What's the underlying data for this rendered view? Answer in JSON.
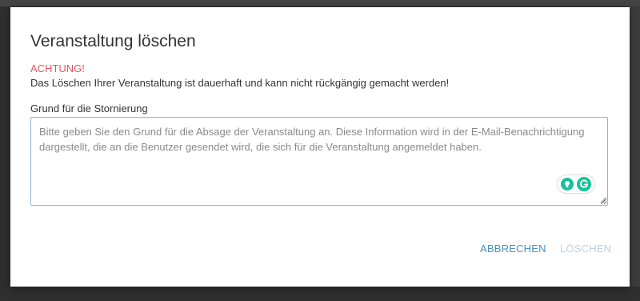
{
  "dialog": {
    "title": "Veranstaltung löschen",
    "warning_label": "ACHTUNG!",
    "warning_text": "Das Löschen Ihrer Veranstaltung ist dauerhaft und kann nicht rückgängig gemacht werden!",
    "reason": {
      "label": "Grund für die Stornierung",
      "value": "",
      "placeholder": "Bitte geben Sie den Grund für die Absage der Veranstaltung an. Diese Information wird in der E-Mail-Benachrichtigung dargestellt, die an die Benutzer gesendet wird, die sich für die Veranstaltung angemeldet haben."
    },
    "buttons": {
      "cancel_label": "ABBRECHEN",
      "delete_label": "LÖSCHEN"
    }
  },
  "colors": {
    "warning": "#e15a5a",
    "primary": "#4a8fc1",
    "primary_disabled": "#b7d3e8",
    "grammarly": "#15c39a"
  },
  "icons": {
    "grammarly_suggestion": "lightbulb-icon",
    "grammarly_logo": "grammarly-g-icon",
    "resize": "resize-grip-icon"
  }
}
